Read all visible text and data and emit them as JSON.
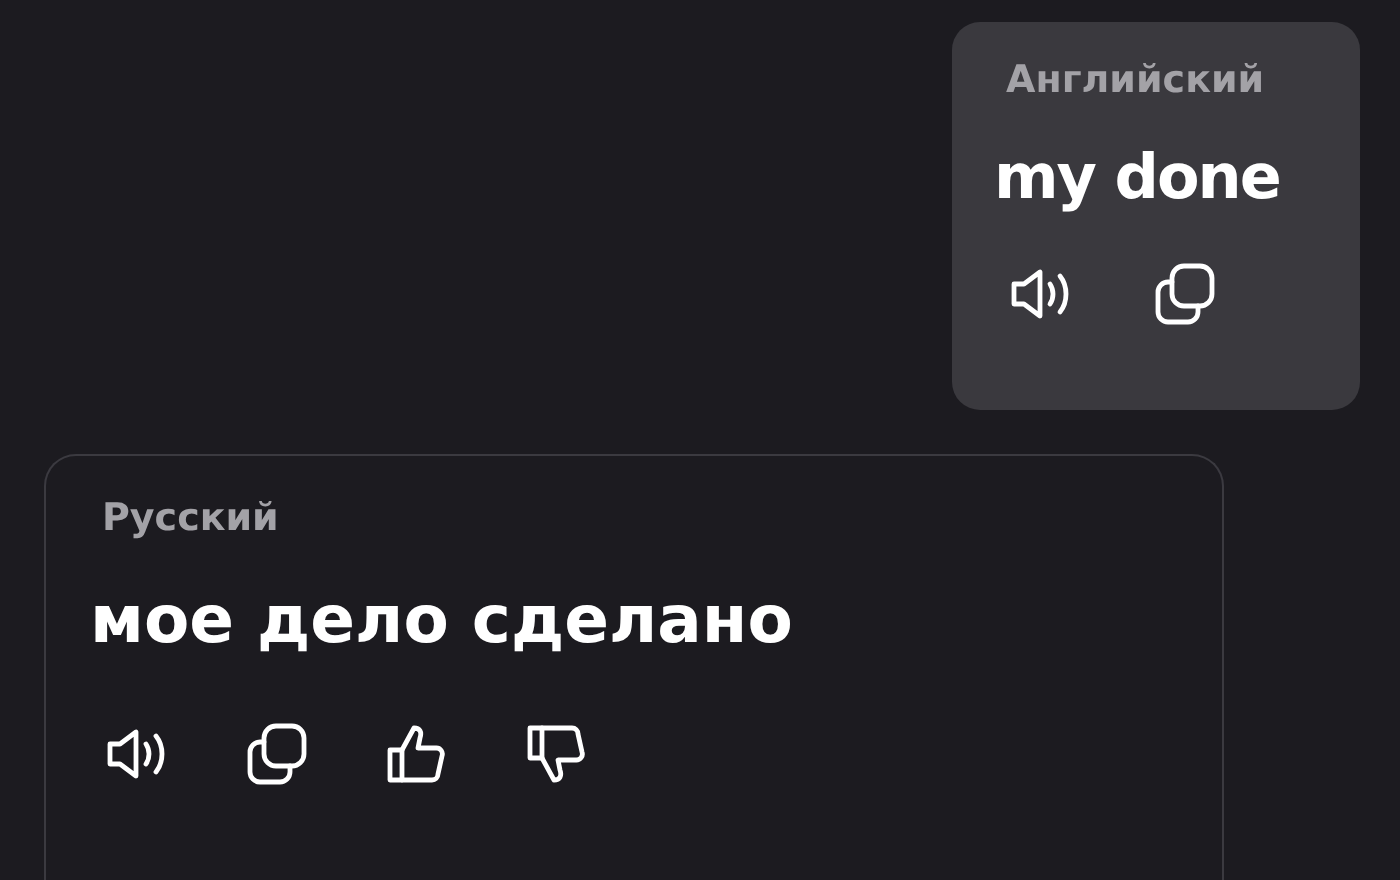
{
  "source": {
    "language": "Английский",
    "text": "my done",
    "actions": [
      {
        "kind": "speaker"
      },
      {
        "kind": "copy"
      }
    ]
  },
  "translation": {
    "language": "Русский",
    "text": "мое дело сделано",
    "actions": [
      {
        "kind": "speaker"
      },
      {
        "kind": "copy"
      },
      {
        "kind": "like"
      },
      {
        "kind": "dislike"
      }
    ]
  }
}
